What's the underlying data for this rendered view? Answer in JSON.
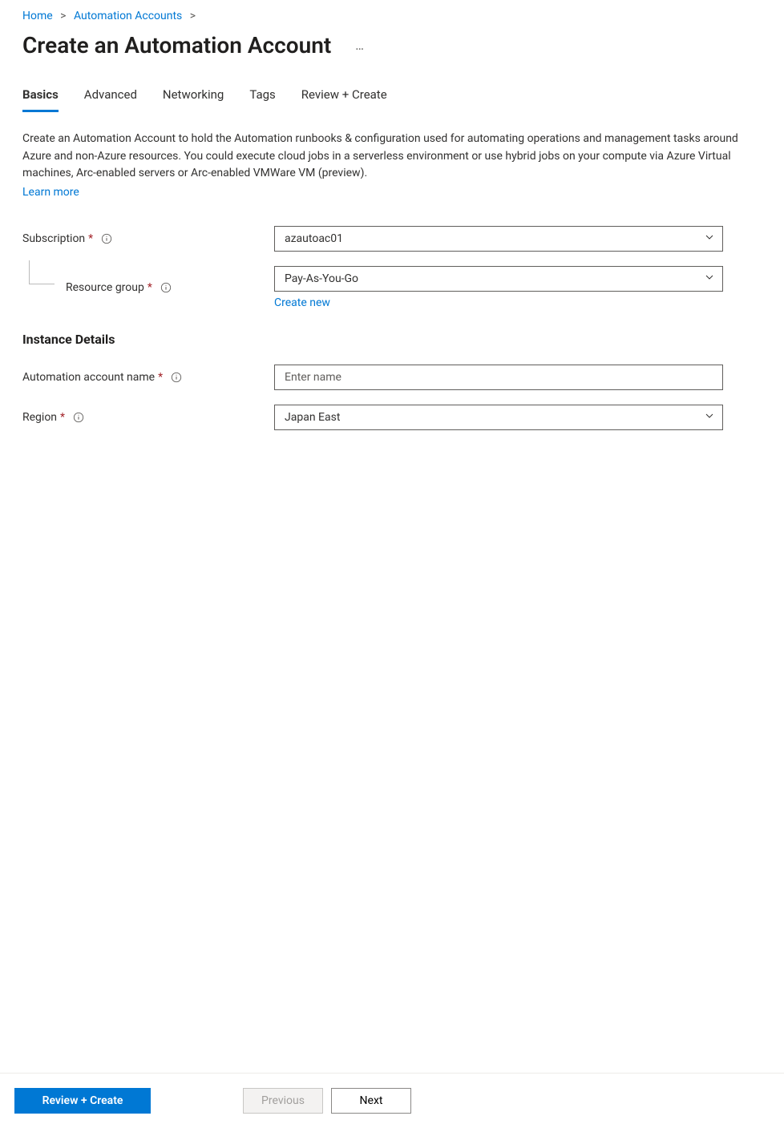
{
  "breadcrumb": {
    "home": "Home",
    "automation_accounts": "Automation Accounts"
  },
  "page_title": "Create an Automation Account",
  "tabs": {
    "basics": "Basics",
    "advanced": "Advanced",
    "networking": "Networking",
    "tags": "Tags",
    "review_create": "Review + Create"
  },
  "description": "Create an Automation Account to hold the Automation runbooks & configuration used for automating operations and management tasks around Azure and non-Azure resources. You could execute cloud jobs in a serverless environment or use hybrid jobs on your compute via Azure Virtual machines, Arc-enabled servers or Arc-enabled VMWare VM (preview).",
  "learn_more_label": "Learn more",
  "fields": {
    "subscription": {
      "label": "Subscription",
      "value": "azautoac01"
    },
    "resource_group": {
      "label": "Resource group",
      "value": "Pay-As-You-Go",
      "create_new": "Create new"
    },
    "instance_details_heading": "Instance Details",
    "automation_account_name": {
      "label": "Automation account name",
      "placeholder": "Enter name",
      "value": ""
    },
    "region": {
      "label": "Region",
      "value": "Japan East"
    }
  },
  "footer": {
    "review_create": "Review + Create",
    "previous": "Previous",
    "next": "Next"
  }
}
